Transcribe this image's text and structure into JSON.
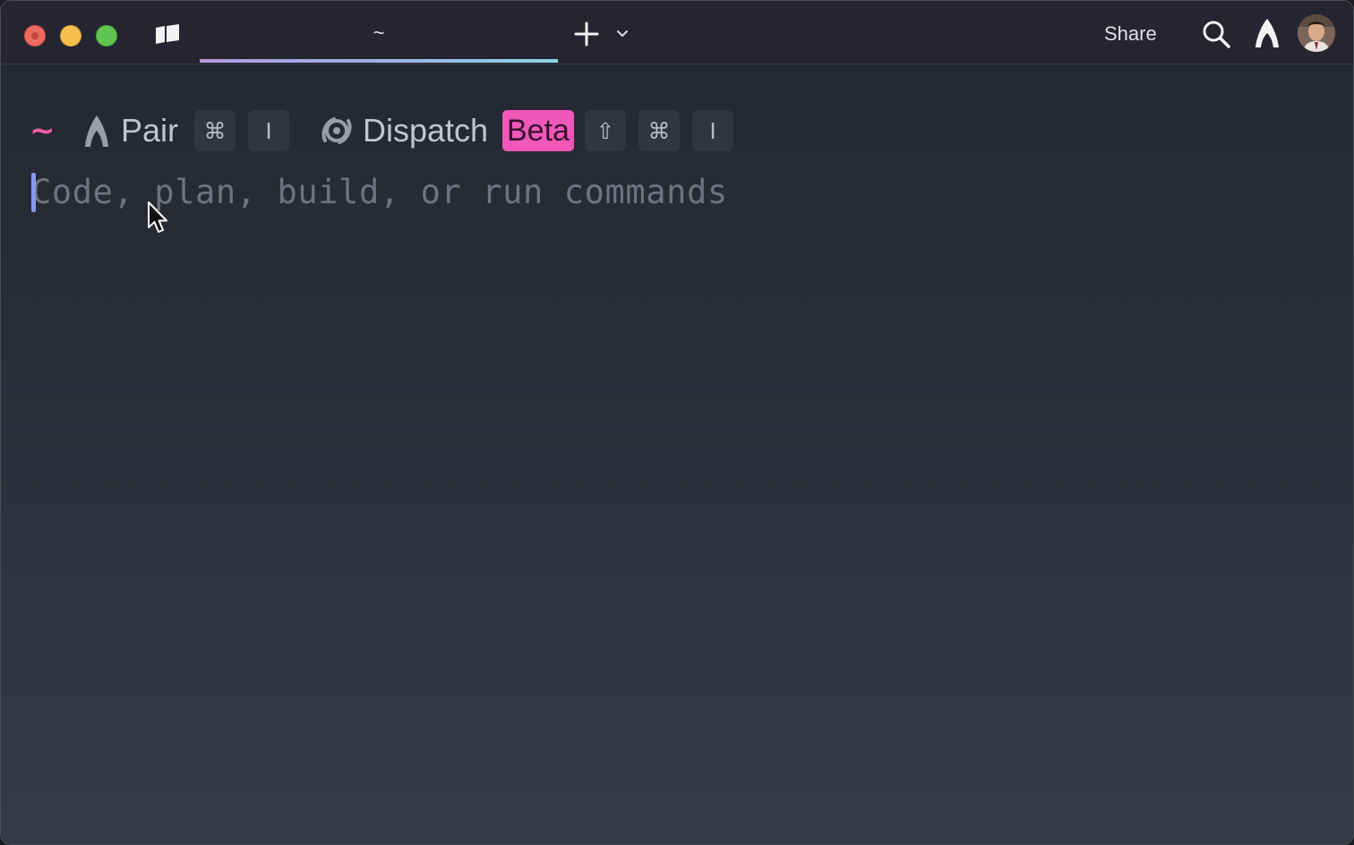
{
  "window": {
    "tab_title": "~",
    "share_label": "Share"
  },
  "colors": {
    "accent_pink": "#ef58b9",
    "caret": "#8c95f3",
    "traffic_close": "#ed6a5e",
    "traffic_minimize": "#f5bf4f",
    "traffic_maximize": "#61c554"
  },
  "icons": {
    "panel": "panel-toggle-icon",
    "new_tab": "plus-icon",
    "tab_menu": "chevron-down-icon",
    "search": "search-icon",
    "agent": "warp-agent-icon",
    "pair": "pair-agent-icon",
    "dispatch": "dispatch-icon",
    "pointer": "mouse-pointer-icon"
  },
  "prompt": {
    "cwd": "~",
    "modes": {
      "pair": {
        "label": "Pair",
        "shortcut_keys": [
          "⌘",
          "I"
        ]
      },
      "dispatch": {
        "label": "Dispatch",
        "badge": "Beta",
        "shortcut_keys": [
          "⇧",
          "⌘",
          "I"
        ]
      }
    },
    "input_placeholder": "Code, plan, build, or run commands"
  }
}
